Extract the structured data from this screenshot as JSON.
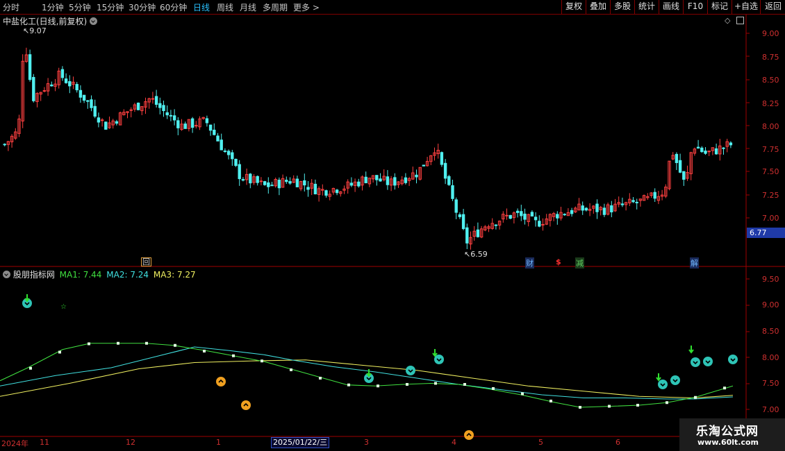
{
  "toolbar": {
    "periods": [
      "分时",
      "1分钟",
      "5分钟",
      "15分钟",
      "30分钟",
      "60分钟",
      "日线",
      "周线",
      "月线",
      "多周期",
      "更多"
    ],
    "active_period": "日线",
    "right_buttons": [
      "复权",
      "叠加",
      "多股",
      "统计",
      "画线",
      "F10",
      "标记",
      "+自选",
      "返回"
    ]
  },
  "main_panel": {
    "title": "中盐化工(日线,前复权)",
    "high_label": "9.07",
    "low_label": "6.59",
    "current_price": "6.77",
    "y_ticks": [
      "9.00",
      "8.75",
      "8.50",
      "8.25",
      "8.00",
      "7.75",
      "7.50",
      "7.25",
      "7.00"
    ],
    "event_tags": [
      {
        "text": "回",
        "color": "#e0a040"
      },
      {
        "text": "财",
        "color": "#6fb7ff"
      },
      {
        "text": "$",
        "color": "#ff3030"
      },
      {
        "text": "减",
        "color": "#60d060"
      },
      {
        "text": "解",
        "color": "#6fb7ff"
      }
    ]
  },
  "indicator_panel": {
    "title": "股朋指标网",
    "ma1_label": "MA1: 7.44",
    "ma2_label": "MA2: 7.24",
    "ma3_label": "MA3: 7.27",
    "ma1_color": "#40e040",
    "ma2_color": "#40e0e0",
    "ma3_color": "#f0f060",
    "y_ticks": [
      "9.50",
      "9.00",
      "8.50",
      "8.00",
      "7.50",
      "7.00"
    ]
  },
  "date_axis": {
    "labels": [
      "2024年",
      "11",
      "12",
      "1",
      "3",
      "4",
      "5",
      "6"
    ],
    "selected_date": "2025/01/22/三"
  },
  "watermark": {
    "line1": "乐淘公式网",
    "line2": "www.60lt.com"
  },
  "colors": {
    "up": "#ff4040",
    "down": "#50f0f0",
    "axis": "#a00000"
  }
}
